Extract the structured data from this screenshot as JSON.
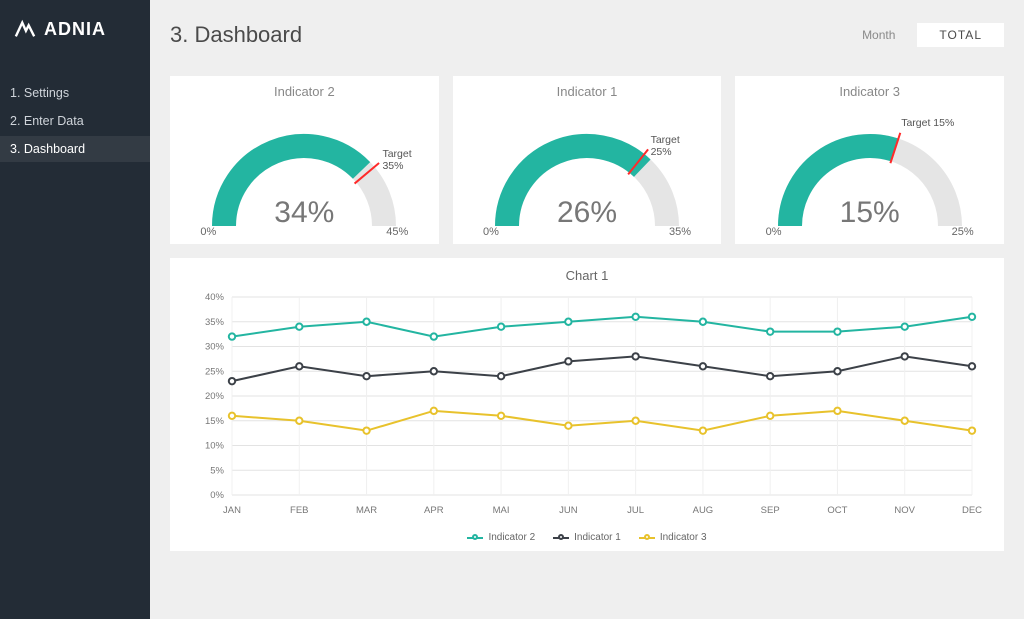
{
  "brand": "ADNIA",
  "nav": {
    "items": [
      {
        "label": "1. Settings"
      },
      {
        "label": "2. Enter Data"
      },
      {
        "label": "3. Dashboard"
      }
    ],
    "activeIndex": 2
  },
  "header": {
    "title": "3. Dashboard",
    "toggle": {
      "month": "Month",
      "total": "TOTAL"
    }
  },
  "gauges": [
    {
      "title": "Indicator 2",
      "value": 34,
      "valueLabel": "34%",
      "min": "0%",
      "max": 45,
      "maxLabel": "45%",
      "target": 35,
      "targetLabel": "Target 35%"
    },
    {
      "title": "Indicator 1",
      "value": 26,
      "valueLabel": "26%",
      "min": "0%",
      "max": 35,
      "maxLabel": "35%",
      "target": 25,
      "targetLabel": "Target 25%"
    },
    {
      "title": "Indicator 3",
      "value": 15,
      "valueLabel": "15%",
      "min": "0%",
      "max": 25,
      "maxLabel": "25%",
      "target": 15,
      "targetLabel": "Target 15%"
    }
  ],
  "colors": {
    "teal": "#23b5a1",
    "dark": "#3c4148",
    "yellow": "#e8c22c",
    "gaugeTrack": "#e5e5e5",
    "needle": "#ff2a2a"
  },
  "chart_data": {
    "type": "line",
    "title": "Chart 1",
    "categories": [
      "JAN",
      "FEB",
      "MAR",
      "APR",
      "MAI",
      "JUN",
      "JUL",
      "AUG",
      "SEP",
      "OCT",
      "NOV",
      "DEC"
    ],
    "series": [
      {
        "name": "Indicator 2",
        "color": "#23b5a1",
        "values": [
          32,
          34,
          35,
          32,
          34,
          35,
          36,
          35,
          33,
          33,
          34,
          36
        ]
      },
      {
        "name": "Indicator 1",
        "color": "#3c4148",
        "values": [
          23,
          26,
          24,
          25,
          24,
          27,
          28,
          26,
          24,
          25,
          28,
          26
        ]
      },
      {
        "name": "Indicator 3",
        "color": "#e8c22c",
        "values": [
          16,
          15,
          13,
          17,
          16,
          14,
          15,
          13,
          16,
          17,
          15,
          13
        ]
      }
    ],
    "xlabel": "",
    "ylabel": "",
    "ylim": [
      0,
      40
    ],
    "ytick": 5,
    "yformat": "percent"
  }
}
